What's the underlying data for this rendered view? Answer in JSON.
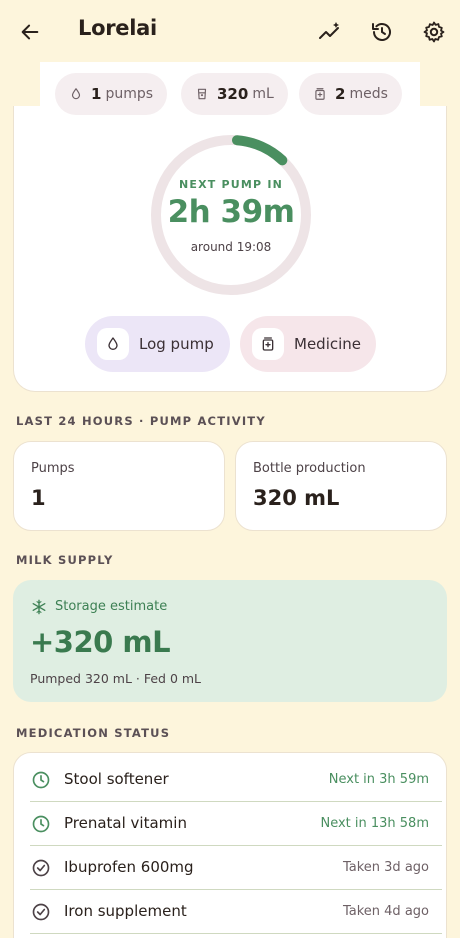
{
  "header": {
    "title": "Lorelai",
    "icons": [
      "back-arrow-icon",
      "trend-sparkle-icon",
      "history-icon",
      "settings-gear-icon"
    ]
  },
  "summary_chips": [
    {
      "icon": "drop-icon",
      "value": "1",
      "label": "pumps"
    },
    {
      "icon": "bottle-icon",
      "value": "320",
      "label": "mL"
    },
    {
      "icon": "medicine-icon",
      "value": "2",
      "label": "meds"
    }
  ],
  "hero": {
    "next_label": "NEXT PUMP IN",
    "countdown": "2h 39m",
    "around": "around 19:08",
    "progress_fraction": 0.12,
    "log_pump_label": "Log pump",
    "medicine_label": "Medicine"
  },
  "activity": {
    "section_title": "LAST 24 HOURS · PUMP ACTIVITY",
    "pumps_label": "Pumps",
    "pumps_value": "1",
    "bottle_label": "Bottle production",
    "bottle_value": "320 mL"
  },
  "supply": {
    "section_title": "MILK SUPPLY",
    "storage_label": "Storage estimate",
    "storage_value": "+320 mL",
    "detail": "Pumped 320 mL · Fed 0 mL"
  },
  "medication": {
    "section_title": "MEDICATION STATUS",
    "items": [
      {
        "name": "Stool softener",
        "status": "Next in 3h 59m",
        "state": "upcoming"
      },
      {
        "name": "Prenatal vitamin",
        "status": "Next in 13h 58m",
        "state": "upcoming"
      },
      {
        "name": "Ibuprofen 600mg",
        "status": "Taken 3d ago",
        "state": "taken"
      },
      {
        "name": "Iron supplement",
        "status": "Taken 4d ago",
        "state": "taken"
      }
    ]
  },
  "colors": {
    "background": "#fdf5dc",
    "accent_green": "#4a8f60",
    "log_pill": "#ece6f7",
    "medicine_pill": "#f6e6ea",
    "storage_card": "#dfeee2"
  }
}
